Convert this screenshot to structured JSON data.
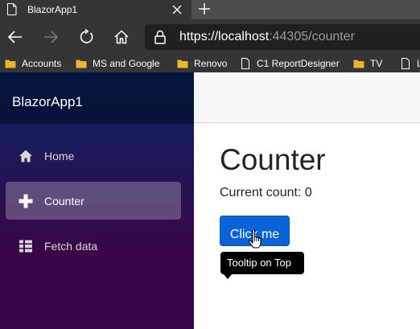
{
  "browser": {
    "tab": {
      "title": "BlazorApp1",
      "favicon": "document-icon",
      "close": "close-icon"
    },
    "new_tab": "plus-icon",
    "nav": {
      "back": "arrow-left-icon",
      "forward": "arrow-right-icon",
      "refresh": "refresh-icon",
      "home": "home-icon"
    },
    "address": {
      "scheme": "https://",
      "host": "localhost",
      "rest": ":44305/counter"
    },
    "favorites": [
      {
        "label": "Accounts",
        "icon": "folder-icon"
      },
      {
        "label": "MS and Google",
        "icon": "folder-icon"
      },
      {
        "label": "Renovo",
        "icon": "folder-icon"
      },
      {
        "label": "C1 ReportDesigner",
        "icon": "document-icon"
      },
      {
        "label": "TV",
        "icon": "folder-icon"
      },
      {
        "label": "Lo",
        "icon": "document-icon"
      }
    ]
  },
  "app": {
    "brand": "BlazorApp1",
    "nav_items": [
      {
        "label": "Home",
        "icon": "home-icon",
        "active": false
      },
      {
        "label": "Counter",
        "icon": "plus-icon",
        "active": true
      },
      {
        "label": "Fetch data",
        "icon": "list-icon",
        "active": false
      }
    ],
    "page": {
      "title": "Counter",
      "count_text": "Current count: 0",
      "button_label": "Click me",
      "tooltip": "Tooltip on Top"
    }
  },
  "colors": {
    "sidebar_top": "#052767",
    "sidebar_bottom": "#3a0647",
    "primary_button": "#0a64d8",
    "folder": "#e8b630",
    "browser_chrome": "#353535"
  }
}
